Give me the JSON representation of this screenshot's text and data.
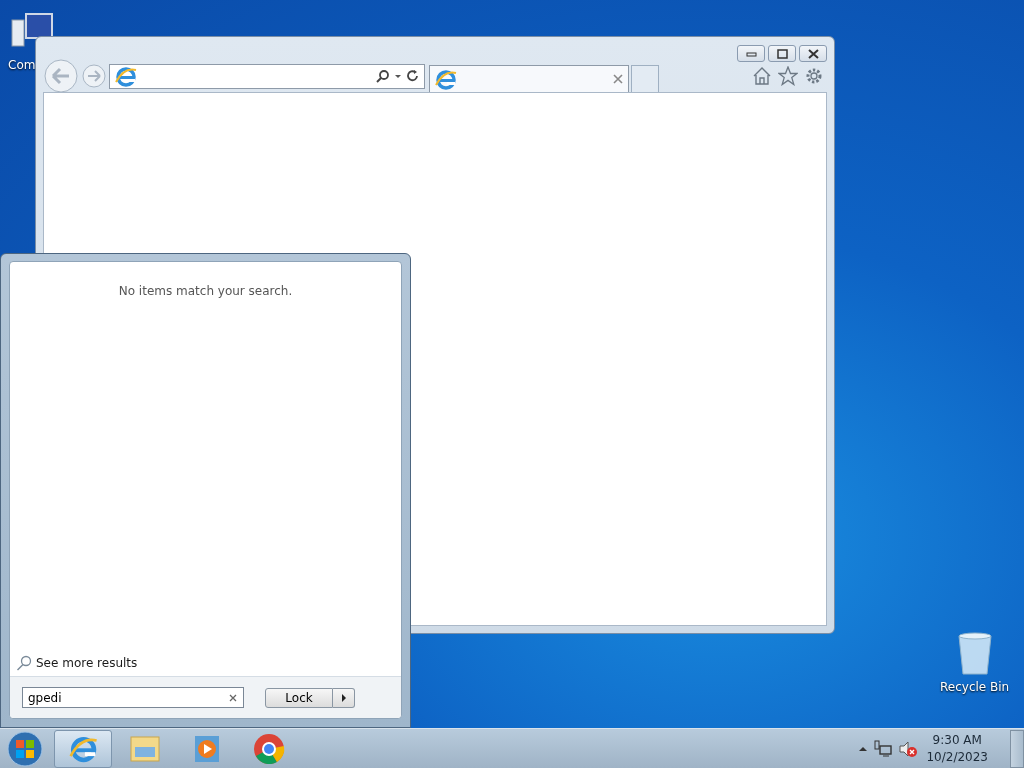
{
  "desktop_icons": [
    {
      "kind": "computer",
      "label": "Com"
    },
    {
      "kind": "recycle",
      "label": "Recycle Bin"
    }
  ],
  "browser": {
    "tabs": [
      {
        "selected": true
      }
    ]
  },
  "start_menu": {
    "message": "No items match your search.",
    "see_more": "See more results",
    "search": {
      "value": "gpedi"
    },
    "power_button": "Lock"
  },
  "taskbar": {
    "items": [
      {
        "kind": "ie",
        "selected": true
      },
      {
        "kind": "explorer",
        "selected": false
      },
      {
        "kind": "media",
        "selected": false
      },
      {
        "kind": "chrome",
        "selected": false
      }
    ]
  },
  "tray": {
    "volume_muted": true
  },
  "clock": {
    "time": "9:30 AM",
    "date": "10/2/2023"
  }
}
